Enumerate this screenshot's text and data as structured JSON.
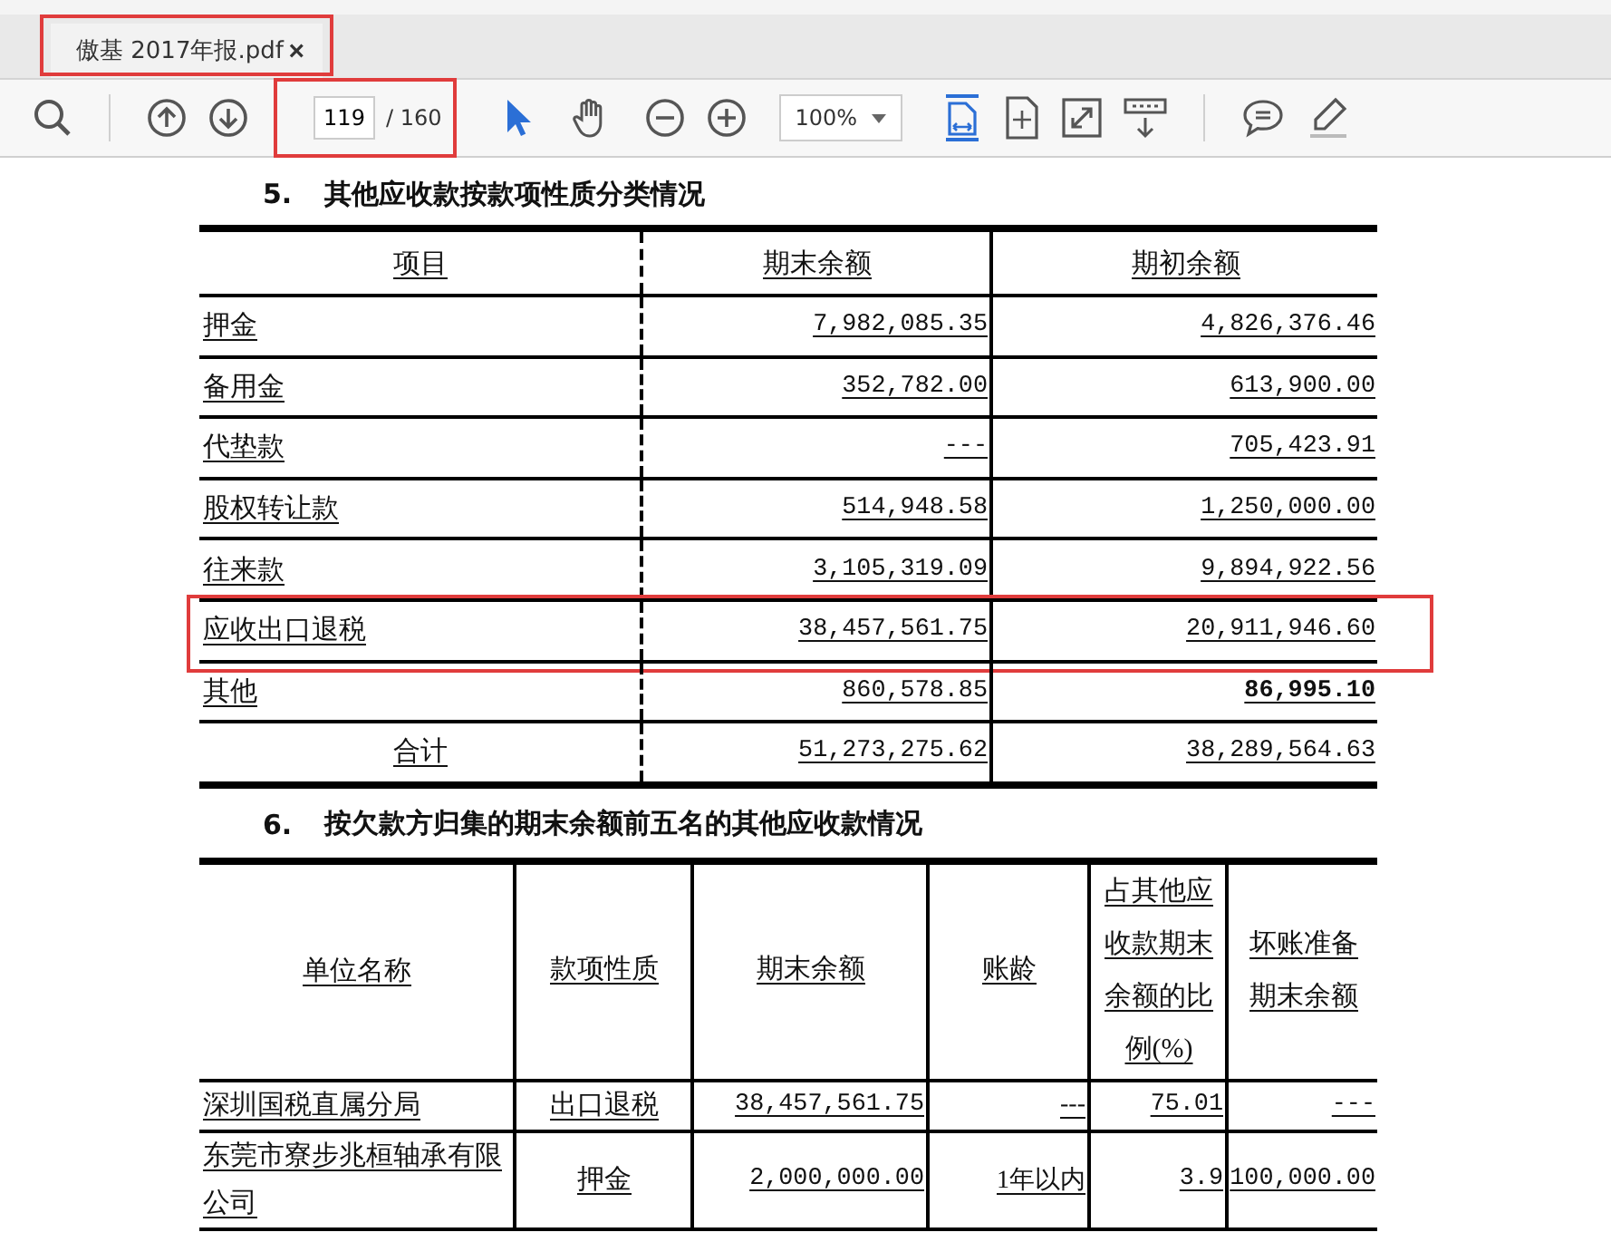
{
  "tabs": [
    {
      "title": "傲基 2017年报.pdf",
      "close": "×",
      "selected": true,
      "highlighted": true
    }
  ],
  "toolbar": {
    "page": "119",
    "page_total": "/ 160",
    "page_highlighted": true,
    "zoom": "100%",
    "tools": [
      {
        "kind": "select",
        "selected": true
      },
      {
        "kind": "hand",
        "selected": false
      }
    ]
  },
  "section_5": {
    "number": "5.",
    "heading": "其他应收款按款项性质分类情况",
    "columns": [
      "项目",
      "期末余额",
      "期初余额"
    ],
    "rows": [
      {
        "kind": "item",
        "highlighted": false,
        "cells": [
          "押金",
          "7,982,085.35",
          "4,826,376.46"
        ]
      },
      {
        "kind": "item",
        "highlighted": false,
        "cells": [
          "备用金",
          "352,782.00",
          "613,900.00"
        ]
      },
      {
        "kind": "item",
        "highlighted": false,
        "cells": [
          "代垫款",
          "---",
          "705,423.91"
        ]
      },
      {
        "kind": "item",
        "highlighted": false,
        "cells": [
          "股权转让款",
          "514,948.58",
          "1,250,000.00"
        ]
      },
      {
        "kind": "item",
        "highlighted": false,
        "cells": [
          "往来款",
          "3,105,319.09",
          "9,894,922.56"
        ]
      },
      {
        "kind": "item",
        "highlighted": true,
        "cells": [
          "应收出口退税",
          "38,457,561.75",
          "20,911,946.60"
        ]
      },
      {
        "kind": "item",
        "highlighted": false,
        "cells": [
          "其他",
          "860,578.85",
          {
            "text": "86,995.10",
            "bold": true
          }
        ]
      },
      {
        "kind": "total",
        "highlighted": false,
        "cells": [
          "合计",
          "51,273,275.62",
          "38,289,564.63"
        ]
      }
    ]
  },
  "section_6": {
    "number": "6.",
    "heading": "按欠款方归集的期末余额前五名的其他应收款情况",
    "columns": [
      "单位名称",
      "款项性质",
      "期末余额",
      "账龄",
      "占其他应收款期末余额的比例(%)",
      "坏账准备期末余额"
    ],
    "rows": [
      {
        "cells": [
          "深圳国税直属分局",
          "出口退税",
          "38,457,561.75",
          "---",
          "75.01",
          "---"
        ]
      },
      {
        "cells": [
          "东莞市寮步兆桓轴承有限公司",
          "押金",
          "2,000,000.00",
          "1年以内",
          "3.9",
          "100,000.00"
        ]
      }
    ]
  }
}
